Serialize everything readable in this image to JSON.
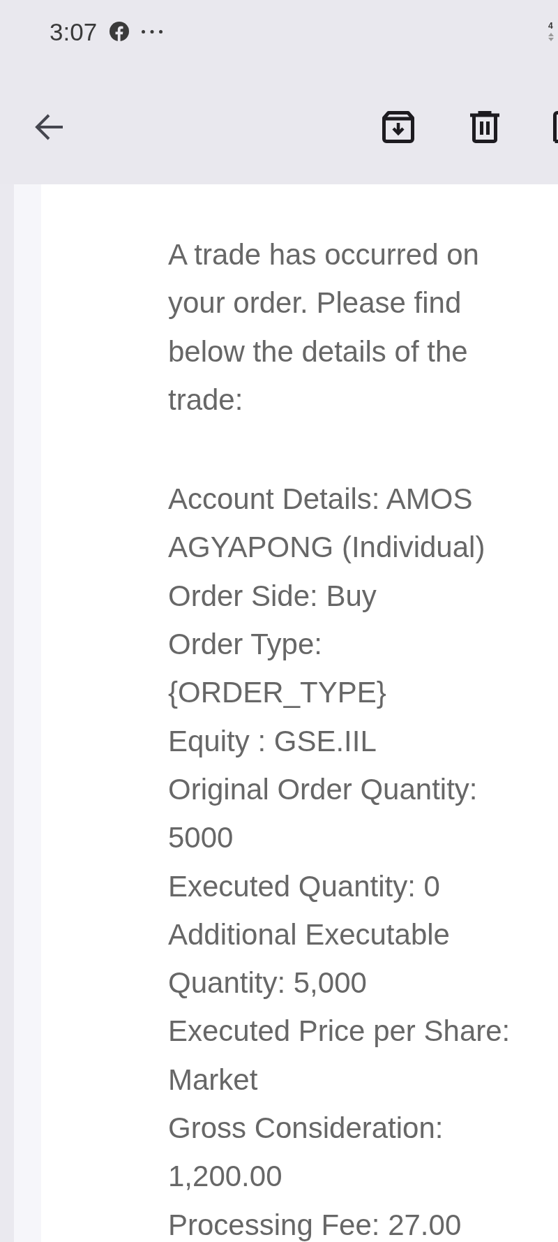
{
  "status_bar": {
    "time": "3:07",
    "network": "4"
  },
  "email": {
    "intro": "A trade has occurred on your order. Please find below the details of the trade:",
    "details": [
      "Account Details: AMOS AGYAPONG (Individual)",
      "Order Side: Buy",
      "Order Type: {ORDER_TYPE}",
      "Equity : GSE.IIL",
      "Original Order Quantity: 5000",
      "Executed Quantity: 0",
      "Additional Executable Quantity: 5,000",
      "Executed Price per Share: Market",
      "Gross Consideration: 1,200.00",
      "Processing Fee: 27.00"
    ]
  }
}
